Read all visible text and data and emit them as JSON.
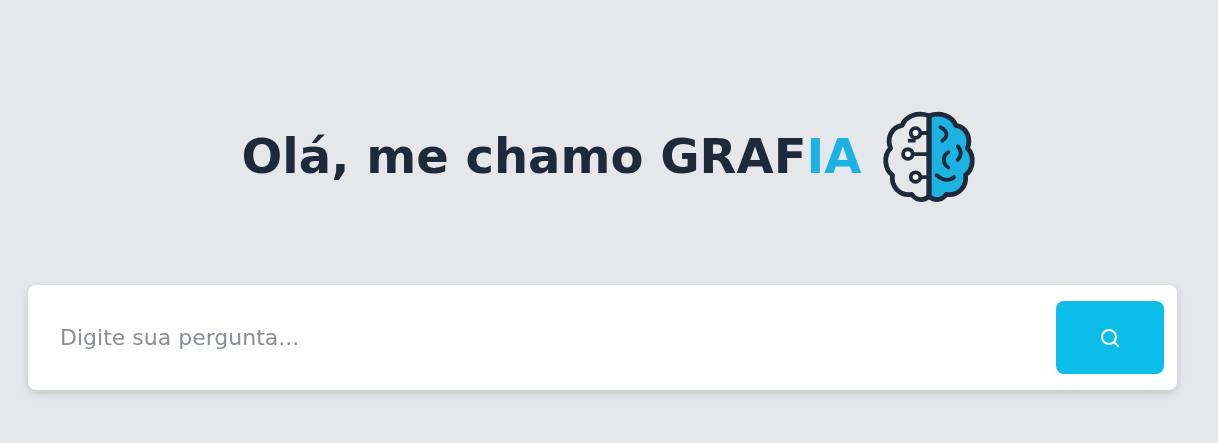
{
  "heading": {
    "text": "Olá, me chamo GRAF",
    "highlight": "IA"
  },
  "search": {
    "placeholder": "Digite sua pergunta..."
  }
}
